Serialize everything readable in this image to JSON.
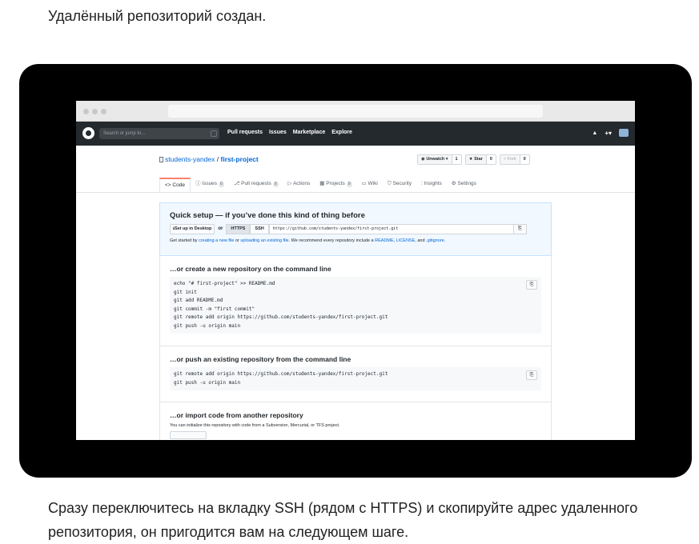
{
  "intro_text": "Удалённый репозиторий создан.",
  "outro_text": "Сразу переключитесь на вкладку SSH (рядом с HTTPS) и скопируйте адрес удаленного репозитория, он пригодится вам на следующем шаге.",
  "github": {
    "search_placeholder": "Search or jump to...",
    "nav": [
      "Pull requests",
      "Issues",
      "Marketplace",
      "Explore"
    ],
    "right_icons": [
      "bell-icon",
      "plus-icon",
      "avatar"
    ],
    "plus_label": "+▾",
    "bell_glyph": "🔔"
  },
  "repo": {
    "owner": "students-yandex",
    "separator": "/",
    "name": "first-project",
    "unwatch_label": "Unwatch ▾",
    "unwatch_count": "1",
    "star_label": "Star",
    "star_count": "0",
    "fork_label": "Fork",
    "fork_count": "0"
  },
  "tabs": [
    {
      "label": "Code",
      "icon": "code-icon",
      "glyph": "<>",
      "badge": ""
    },
    {
      "label": "Issues",
      "icon": "issue-icon",
      "glyph": "ⓘ",
      "badge": "0"
    },
    {
      "label": "Pull requests",
      "icon": "pr-icon",
      "glyph": "⎇",
      "badge": "0"
    },
    {
      "label": "Actions",
      "icon": "actions-icon",
      "glyph": "▷",
      "badge": ""
    },
    {
      "label": "Projects",
      "icon": "projects-icon",
      "glyph": "▦",
      "badge": "0"
    },
    {
      "label": "Wiki",
      "icon": "wiki-icon",
      "glyph": "▭",
      "badge": ""
    },
    {
      "label": "Security",
      "icon": "shield-icon",
      "glyph": "⛉",
      "badge": ""
    },
    {
      "label": "Insights",
      "icon": "graph-icon",
      "glyph": "⫶",
      "badge": ""
    },
    {
      "label": "Settings",
      "icon": "gear-icon",
      "glyph": "⚙",
      "badge": ""
    }
  ],
  "quick_setup": {
    "title": "Quick setup — if you’ve done this kind of thing before",
    "desktop_button": "Set up in Desktop",
    "or": "or",
    "https": "HTTPS",
    "ssh": "SSH",
    "url": "https://github.com/students-yandex/first-project.git",
    "get_started_prefix": "Get started by",
    "link_new_file": "creating a new file",
    "or_word": "or",
    "link_upload": "uploading an existing file",
    "recommend": ". We recommend every repository include a",
    "link_readme": "README",
    "comma": ",",
    "link_license": "LICENSE",
    "and_word": ", and",
    "link_gitignore": ".gitignore",
    "period": "."
  },
  "new_repo": {
    "title": "…or create a new repository on the command line",
    "code": "echo \"# first-project\" >> README.md\ngit init\ngit add README.md\ngit commit -m \"first commit\"\ngit remote add origin https://github.com/students-yandex/first-project.git\ngit push -u origin main"
  },
  "push_existing": {
    "title": "…or push an existing repository from the command line",
    "code": "git remote add origin https://github.com/students-yandex/first-project.git\ngit push -u origin main"
  },
  "import": {
    "title": "…or import code from another repository",
    "description": "You can initialize this repository with code from a Subversion, Mercurial, or TFS project."
  }
}
